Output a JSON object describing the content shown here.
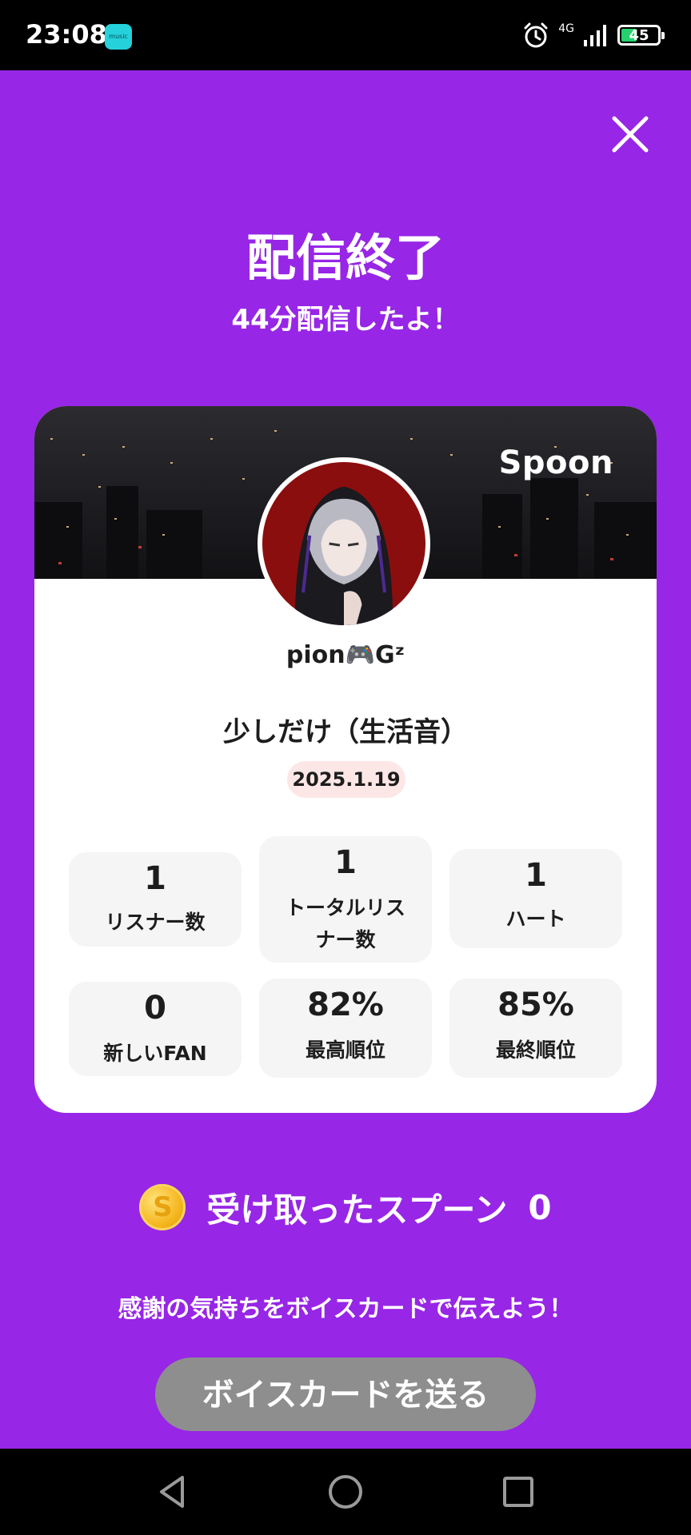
{
  "status_bar": {
    "time": "23:08",
    "app_badge": "music",
    "network": "4G",
    "battery": "45",
    "battery_level": 0.45,
    "icons": [
      "alarm-icon",
      "signal-icon",
      "battery-icon"
    ]
  },
  "header": {
    "title": "配信終了",
    "subtitle": "44分配信したよ！"
  },
  "card": {
    "brand": "Spoon",
    "username": "pion🎮Gᶻ",
    "live_title": "少しだけ（生活音）",
    "date": "2025.1.19",
    "stats": [
      {
        "value": "1",
        "label": "リスナー数"
      },
      {
        "value": "1",
        "label": "トータルリス",
        "label2": "ナー数"
      },
      {
        "value": "1",
        "label": "ハート"
      },
      {
        "value": "0",
        "label": "新しいFAN"
      },
      {
        "value": "82%",
        "label": "最高順位"
      },
      {
        "value": "85%",
        "label": "最終順位"
      }
    ]
  },
  "spoons": {
    "coin": "S",
    "text": "受け取ったスプーン",
    "count": "0"
  },
  "thanks_text": "感謝の気持ちをボイスカードで伝えよう！",
  "voice_card_button": "ボイスカードを送る",
  "colors": {
    "background": "#9726e6",
    "card": "#ffffff",
    "stat_box": "#f5f5f5",
    "date_pill": "#fde7e6",
    "button": "#8e8e8e"
  },
  "nav": [
    "back-icon",
    "home-icon",
    "recents-icon"
  ]
}
